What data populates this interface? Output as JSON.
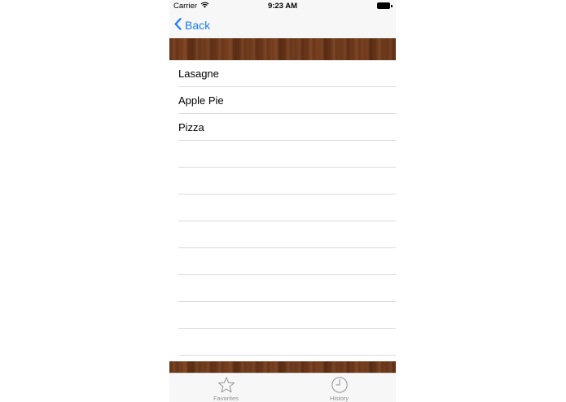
{
  "status_bar": {
    "carrier": "Carrier",
    "time": "9:23 AM",
    "wifi_icon": "wifi-icon",
    "battery_icon": "battery-icon"
  },
  "nav_bar": {
    "back_label": "Back",
    "back_icon": "chevron-left-icon",
    "tint_color": "#1a7cf5"
  },
  "list": {
    "items": [
      {
        "label": "Lasagne"
      },
      {
        "label": "Apple Pie"
      },
      {
        "label": "Pizza"
      }
    ],
    "empty_row_count": 8
  },
  "tab_bar": {
    "tabs": [
      {
        "label": "Favorites",
        "icon": "star-icon"
      },
      {
        "label": "History",
        "icon": "clock-icon"
      }
    ]
  },
  "colors": {
    "wood": "#6f3a1c",
    "separator": "#dcdcdf",
    "bar_background": "#f7f7f7",
    "tab_inactive": "#929292"
  }
}
